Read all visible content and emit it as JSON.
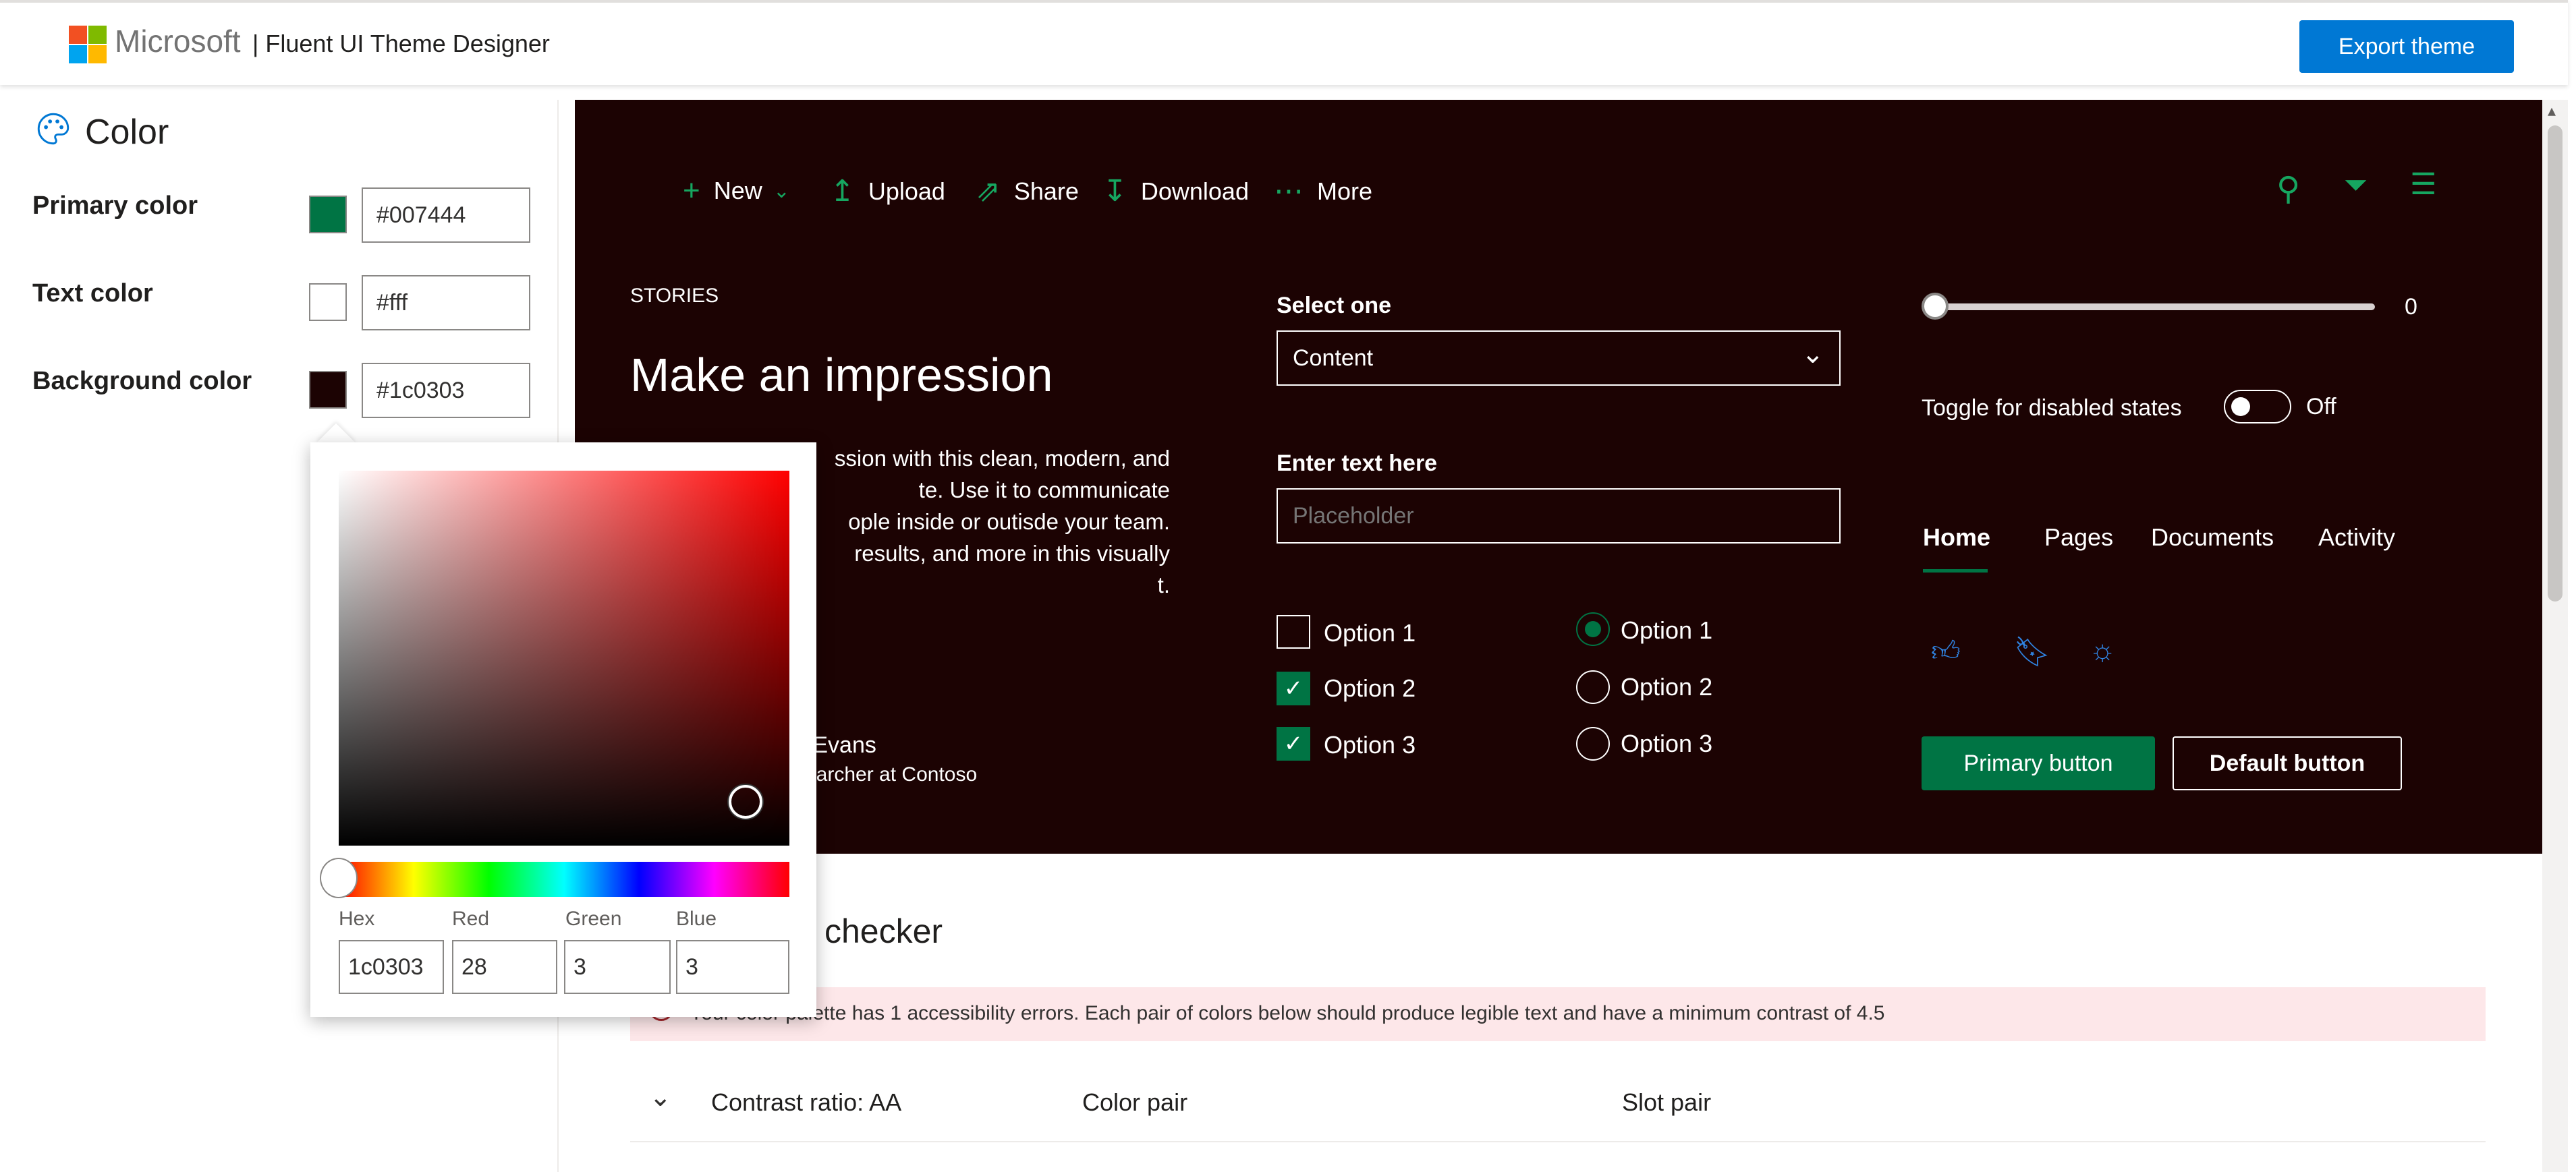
{
  "header": {
    "brand": "Microsoft",
    "product": "| Fluent UI Theme Designer",
    "export_label": "Export theme"
  },
  "sidebar": {
    "title": "Color",
    "rows": [
      {
        "label": "Primary color",
        "value": "#007444",
        "swatch": "#007444"
      },
      {
        "label": "Text color",
        "value": "#fff",
        "swatch": "#ffffff"
      },
      {
        "label": "Background color",
        "value": "#1c0303",
        "swatch": "#1c0303"
      }
    ]
  },
  "preview": {
    "commands": [
      "New",
      "Upload",
      "Share",
      "Download",
      "More"
    ],
    "stories": "STORIES",
    "heading": "Make an impression",
    "body_lines": [
      "ssion with this clean, modern, and",
      "te. Use it to communicate",
      "ople inside or outisde your team.",
      "results, and more in this visually",
      "t."
    ],
    "author": "n Evans",
    "author_role": "searcher at Contoso",
    "select_label": "Select one",
    "select_value": "Content",
    "text_label": "Enter text here",
    "text_placeholder": "Placeholder",
    "checkboxes": [
      {
        "label": "Option 1",
        "checked": false
      },
      {
        "label": "Option 2",
        "checked": true
      },
      {
        "label": "Option 3",
        "checked": true
      }
    ],
    "radios": [
      {
        "label": "Option 1",
        "selected": true
      },
      {
        "label": "Option 2",
        "selected": false
      },
      {
        "label": "Option 3",
        "selected": false
      }
    ],
    "slider_value": "0",
    "toggle_label": "Toggle for disabled states",
    "toggle_state": "Off",
    "tabs": [
      "Home",
      "Pages",
      "Documents",
      "Activity"
    ],
    "primary_button": "Primary button",
    "default_button": "Default button"
  },
  "checker": {
    "title": "checker",
    "error": "Your color palette has 1 accessibility errors. Each pair of colors below should produce legible text and have a minimum contrast of 4.5",
    "columns": [
      "Contrast ratio: AA",
      "Color pair",
      "Slot pair"
    ]
  },
  "picker": {
    "labels": [
      "Hex",
      "Red",
      "Green",
      "Blue"
    ],
    "values": [
      "1c0303",
      "28",
      "3",
      "3"
    ]
  },
  "colors": {
    "accent": "#007444",
    "background": "#1c0303",
    "export_blue": "#0078d4"
  }
}
